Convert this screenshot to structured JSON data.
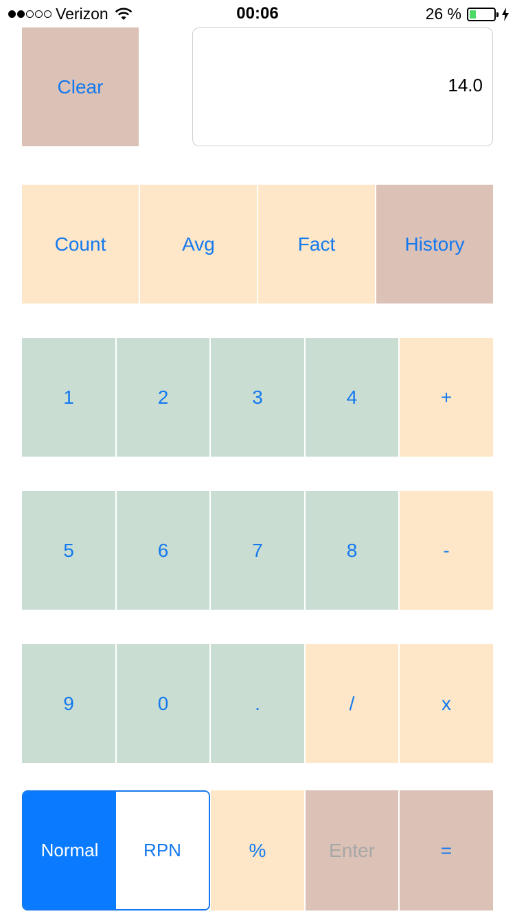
{
  "status_bar": {
    "carrier": "Verizon",
    "time": "00:06",
    "battery_percent_label": "26 %",
    "battery_level": 0.26,
    "signal_bars_filled": 2,
    "signal_bars_total": 5
  },
  "top": {
    "clear_label": "Clear",
    "display_value": "14.0"
  },
  "functions": {
    "count_label": "Count",
    "avg_label": "Avg",
    "fact_label": "Fact",
    "history_label": "History"
  },
  "keypad": {
    "row1": [
      "1",
      "2",
      "3",
      "4",
      "+"
    ],
    "row2": [
      "5",
      "6",
      "7",
      "8",
      "-"
    ],
    "row3": [
      "9",
      "0",
      ".",
      "/",
      "x"
    ]
  },
  "bottom": {
    "mode_options": [
      "Normal",
      "RPN"
    ],
    "mode_selected": "Normal",
    "percent_label": "%",
    "enter_label": "Enter",
    "equals_label": "="
  },
  "colors": {
    "accent": "#1479ee",
    "peach": "#fde7c8",
    "rose": "#dcc1b6",
    "sage": "#c9ddd3",
    "battery": "#4cd964"
  }
}
